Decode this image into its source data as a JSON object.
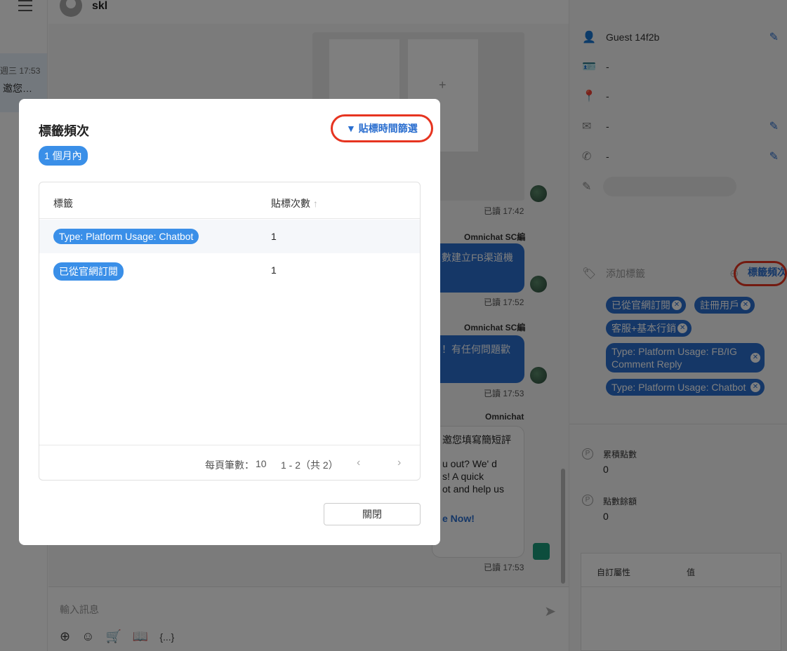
{
  "header": {
    "user_name": "skl"
  },
  "conversation": {
    "time": "週三 17:53",
    "preview": "邀您…"
  },
  "chat": {
    "read_1": "已讀 17:42",
    "sender_1": "Omnichat SC編",
    "bubble_1": "數建立FB渠道機",
    "read_2": "已讀 17:52",
    "sender_2": "Omnichat SC編",
    "bubble_2": "！有任何問題歡",
    "read_3": "已讀 17:53",
    "sender_3": "Omnichat",
    "bubble_3_line1": "邀您填寫簡短評",
    "bubble_3_line2": "u out? We' d",
    "bubble_3_line3": "s! A quick",
    "bubble_3_line4": "ot and help us",
    "bubble_3_cta": "e Now!",
    "read_4": "已讀 17:53",
    "input_placeholder": "輸入訊息",
    "template_icon": "{...}"
  },
  "profile": {
    "name": "Guest 14f2b",
    "id_value": "-",
    "location": "-",
    "email": "-",
    "phone": "-",
    "add_tag_placeholder": "添加標籤",
    "tag_freq_link": "標籤頻次",
    "tags": [
      "已從官網訂閱",
      "註冊用戶",
      "客服+基本行銷",
      "Type: Platform Usage: FB/IG Comment Reply",
      "Type: Platform Usage: Chatbot"
    ],
    "points_label": "累積點數",
    "points_value": "0",
    "balance_label": "點數餘額",
    "balance_value": "0",
    "custom_attr_header": "自訂屬性",
    "custom_value_header": "值"
  },
  "modal": {
    "title": "標籤頻次",
    "filter_label": "貼標時間篩選",
    "period": "1 個月內",
    "col_tag": "標籤",
    "col_count": "貼標次數",
    "rows": [
      {
        "tag": "Type: Platform Usage: Chatbot",
        "count": "1"
      },
      {
        "tag": "已從官網訂閱",
        "count": "1"
      }
    ],
    "page_size_label": "每頁筆數：",
    "page_size": "10",
    "range": "1 - 2（共 2）",
    "close_label": "關閉"
  },
  "colors": {
    "accent": "#2a6ecf",
    "badge": "#3a8fe8",
    "highlight_ring": "#e63420"
  }
}
